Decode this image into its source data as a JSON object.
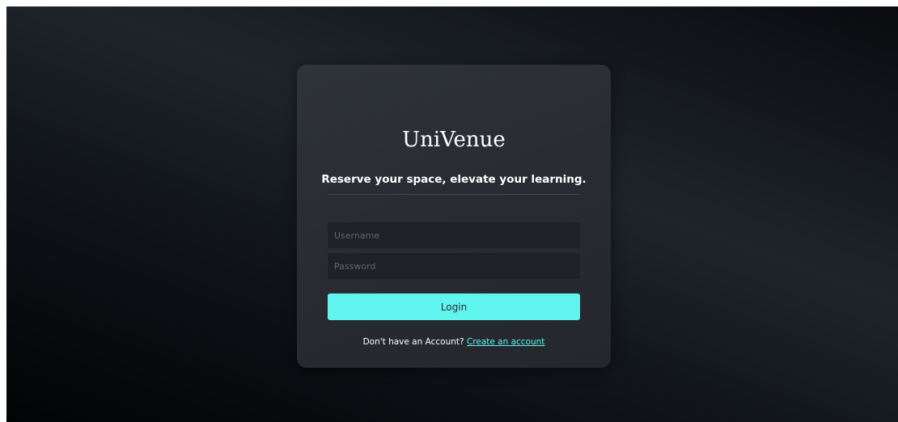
{
  "app": {
    "name": "UniVenue",
    "tagline": "Reserve your space, elevate your learning."
  },
  "login_form": {
    "username": {
      "value": "",
      "placeholder": "Username"
    },
    "password": {
      "value": "",
      "placeholder": "Password"
    },
    "login_label": "Login"
  },
  "signup": {
    "prompt": "Don't have an Account?",
    "link_label": "Create an account"
  },
  "colors": {
    "accent": "#5ff5ee",
    "card_background": "#2b2e34",
    "page_background": "#0d1014",
    "input_background": "#1e2125"
  }
}
